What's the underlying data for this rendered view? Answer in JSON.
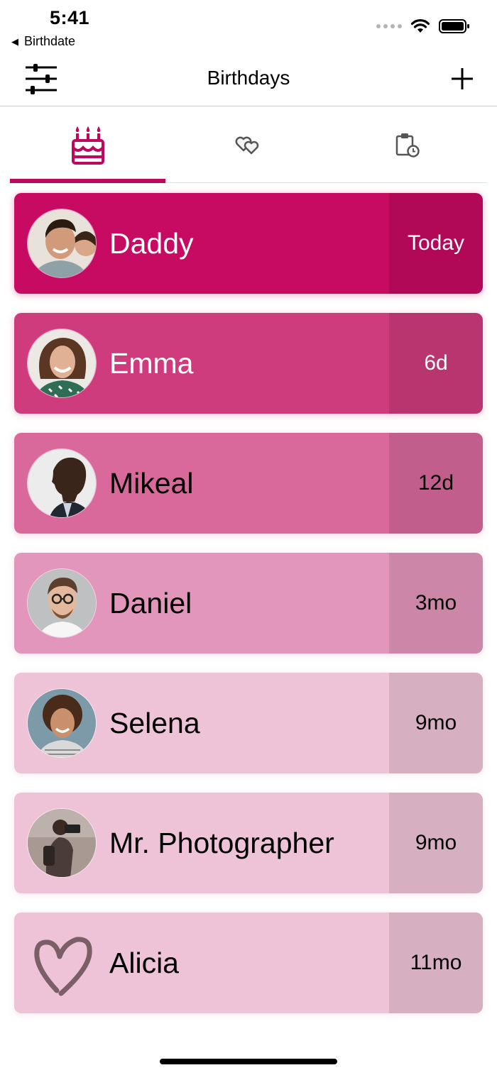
{
  "status_bar": {
    "time": "5:41",
    "back_app": "Birthdate"
  },
  "nav": {
    "title": "Birthdays",
    "left_icon": "sliders-icon",
    "right_icon": "plus-icon"
  },
  "tabs": [
    {
      "icon": "birthday-cake-icon",
      "active": true
    },
    {
      "icon": "hearts-icon",
      "active": false
    },
    {
      "icon": "clipboard-clock-icon",
      "active": false
    }
  ],
  "colors": {
    "accent": "#c0075f",
    "row_text_light": "#ffffff",
    "row_text_dark": "#000000"
  },
  "birthdays": [
    {
      "name": "Daddy",
      "when": "Today",
      "bg": "#c70a62",
      "text": "#ffffff",
      "avatar": "photo"
    },
    {
      "name": "Emma",
      "when": "6d",
      "bg": "#cf3c7d",
      "text": "#ffffff",
      "avatar": "photo"
    },
    {
      "name": "Mikeal",
      "when": "12d",
      "bg": "#d9699b",
      "text": "#000000",
      "avatar": "photo"
    },
    {
      "name": "Daniel",
      "when": "3mo",
      "bg": "#e396bb",
      "text": "#000000",
      "avatar": "photo"
    },
    {
      "name": "Selena",
      "when": "9mo",
      "bg": "#efc3d7",
      "text": "#000000",
      "avatar": "photo"
    },
    {
      "name": "Mr. Photographer",
      "when": "9mo",
      "bg": "#efc3d7",
      "text": "#000000",
      "avatar": "photo"
    },
    {
      "name": "Alicia",
      "when": "11mo",
      "bg": "#efc3d7",
      "text": "#000000",
      "avatar": "heart"
    }
  ]
}
